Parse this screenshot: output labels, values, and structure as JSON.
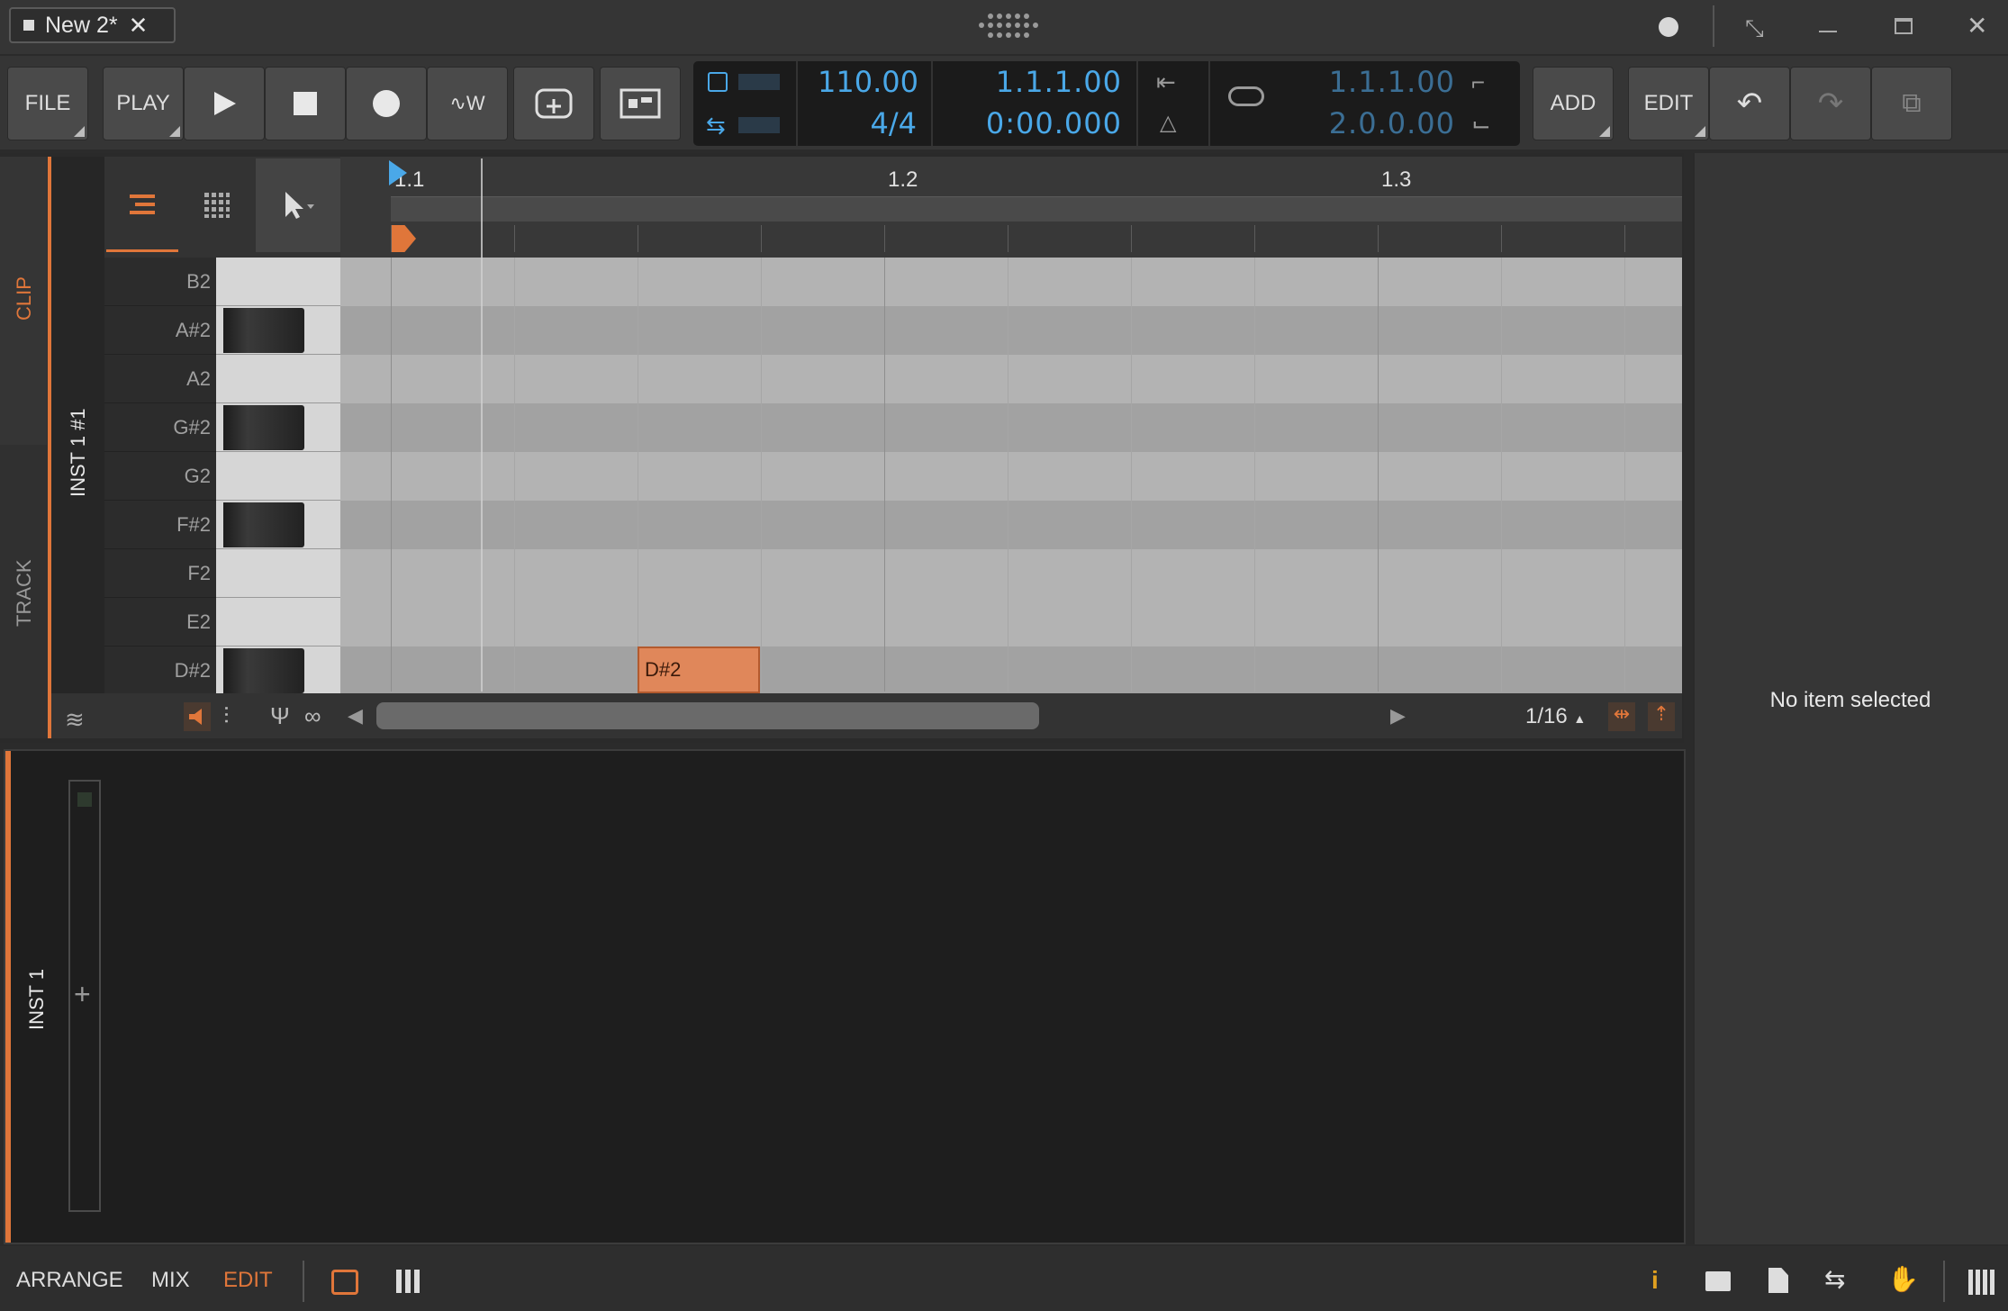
{
  "window": {
    "tab_title": "New 2*"
  },
  "toolbar": {
    "file": "FILE",
    "play": "PLAY",
    "add": "ADD",
    "edit": "EDIT",
    "tempo": "110.00",
    "time_signature": "4/4",
    "position_bars": "1.1.1.00",
    "position_time": "0:00.000",
    "loop_start": "1.1.1.00",
    "loop_end": "2.0.0.00"
  },
  "side_tabs": {
    "clip": "CLIP",
    "track": "TRACK"
  },
  "track": {
    "name": "INST 1 #1"
  },
  "ruler": {
    "markers": [
      "1.1",
      "1.2",
      "1.3"
    ]
  },
  "keys": [
    {
      "label": "B2",
      "black": false
    },
    {
      "label": "A#2",
      "black": true
    },
    {
      "label": "A2",
      "black": false
    },
    {
      "label": "G#2",
      "black": true
    },
    {
      "label": "G2",
      "black": false
    },
    {
      "label": "F#2",
      "black": true
    },
    {
      "label": "F2",
      "black": false
    },
    {
      "label": "E2",
      "black": false
    },
    {
      "label": "D#2",
      "black": true
    }
  ],
  "note": {
    "label": "D#2"
  },
  "grid": {
    "resolution": "1/16"
  },
  "device_panel": {
    "track_name": "INST 1"
  },
  "inspector": {
    "empty_text": "No item selected"
  },
  "status": {
    "arrange": "ARRANGE",
    "mix": "MIX",
    "edit": "EDIT"
  },
  "colors": {
    "accent": "#e0763a",
    "display_blue": "#4aa8e8"
  }
}
